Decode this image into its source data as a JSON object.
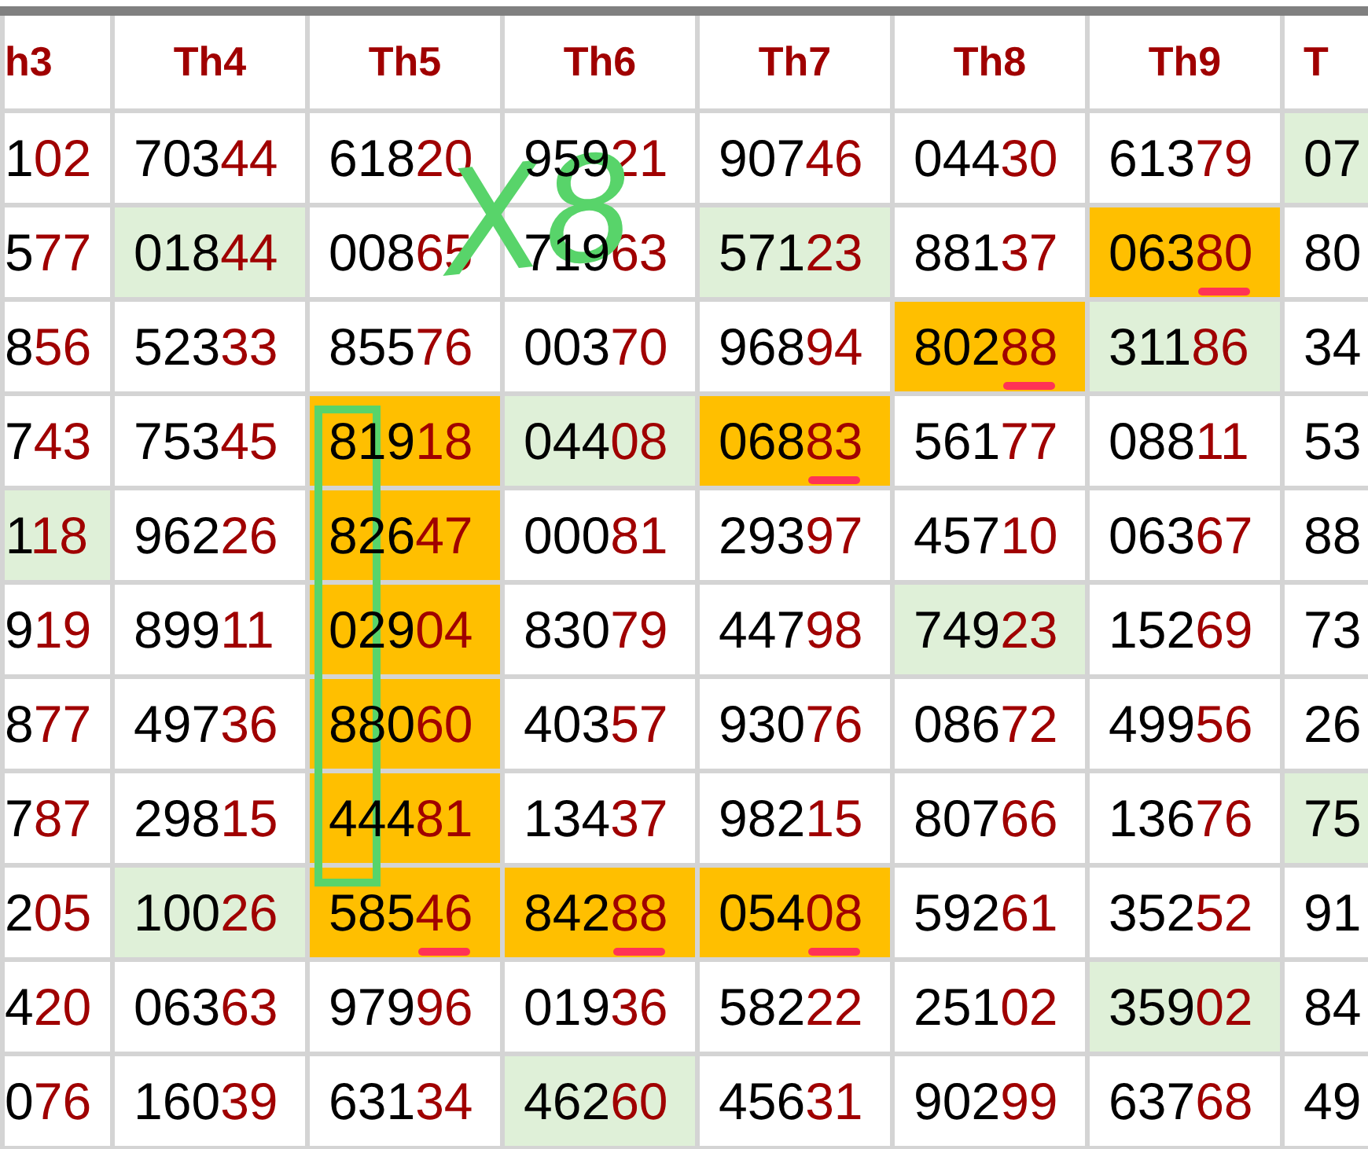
{
  "columns": [
    {
      "label": "h3"
    },
    {
      "label": "Th4"
    },
    {
      "label": "Th5"
    },
    {
      "label": "Th6"
    },
    {
      "label": "Th7"
    },
    {
      "label": "Th8"
    },
    {
      "label": "Th9"
    },
    {
      "label": "T"
    }
  ],
  "rows": [
    [
      {
        "head": "1",
        "tail": "02",
        "color": "#ffffff",
        "underlined": false
      },
      {
        "head": "703",
        "tail": "44",
        "color": "#ffffff",
        "underlined": false
      },
      {
        "head": "618",
        "tail": "20",
        "color": "#ffffff",
        "underlined": false
      },
      {
        "head": "959",
        "tail": "21",
        "color": "#ffffff",
        "underlined": false
      },
      {
        "head": "907",
        "tail": "46",
        "color": "#ffffff",
        "underlined": false
      },
      {
        "head": "044",
        "tail": "30",
        "color": "#ffffff",
        "underlined": false
      },
      {
        "head": "613",
        "tail": "79",
        "color": "#ffffff",
        "underlined": false
      },
      {
        "head": "07",
        "color": "#dff0d8"
      }
    ],
    [
      {
        "head": "5",
        "tail": "77",
        "color": "#ffffff",
        "underlined": false
      },
      {
        "head": "018",
        "tail": "44",
        "color": "#dff0d8",
        "underlined": false
      },
      {
        "head": "008",
        "tail": "65",
        "color": "#ffffff",
        "underlined": false
      },
      {
        "head": "719",
        "tail": "63",
        "color": "#ffffff",
        "underlined": false
      },
      {
        "head": "571",
        "tail": "23",
        "color": "#dff0d8",
        "underlined": false
      },
      {
        "head": "881",
        "tail": "37",
        "color": "#ffffff",
        "underlined": false
      },
      {
        "head": "063",
        "tail": "80",
        "color": "#ffbf00",
        "underlined": true
      },
      {
        "head": "80",
        "color": "#ffffff"
      }
    ],
    [
      {
        "head": "8",
        "tail": "56",
        "color": "#ffffff",
        "underlined": false
      },
      {
        "head": "523",
        "tail": "33",
        "color": "#ffffff",
        "underlined": false
      },
      {
        "head": "855",
        "tail": "76",
        "color": "#ffffff",
        "underlined": false
      },
      {
        "head": "003",
        "tail": "70",
        "color": "#ffffff",
        "underlined": false
      },
      {
        "head": "968",
        "tail": "94",
        "color": "#ffffff",
        "underlined": false
      },
      {
        "head": "802",
        "tail": "88",
        "color": "#ffbf00",
        "underlined": true
      },
      {
        "head": "311",
        "tail": "86",
        "color": "#dff0d8",
        "underlined": false
      },
      {
        "head": "34",
        "color": "#ffffff"
      }
    ],
    [
      {
        "head": "7",
        "tail": "43",
        "color": "#ffffff",
        "underlined": false
      },
      {
        "head": "753",
        "tail": "45",
        "color": "#ffffff",
        "underlined": false
      },
      {
        "head": "819",
        "tail": "18",
        "color": "#ffbf00",
        "underlined": false
      },
      {
        "head": "044",
        "tail": "08",
        "color": "#dff0d8",
        "underlined": false
      },
      {
        "head": "068",
        "tail": "83",
        "color": "#ffbf00",
        "underlined": true
      },
      {
        "head": "561",
        "tail": "77",
        "color": "#ffffff",
        "underlined": false
      },
      {
        "head": "088",
        "tail": "11",
        "color": "#ffffff",
        "underlined": false
      },
      {
        "head": "53",
        "color": "#ffffff"
      }
    ],
    [
      {
        "head": "1",
        "tail": "18",
        "color": "#dff0d8",
        "underlined": false
      },
      {
        "head": "962",
        "tail": "26",
        "color": "#ffffff",
        "underlined": false
      },
      {
        "head": "826",
        "tail": "47",
        "color": "#ffbf00",
        "underlined": false
      },
      {
        "head": "000",
        "tail": "81",
        "color": "#ffffff",
        "underlined": false
      },
      {
        "head": "293",
        "tail": "97",
        "color": "#ffffff",
        "underlined": false
      },
      {
        "head": "457",
        "tail": "10",
        "color": "#ffffff",
        "underlined": false
      },
      {
        "head": "063",
        "tail": "67",
        "color": "#ffffff",
        "underlined": false
      },
      {
        "head": "88",
        "color": "#ffffff"
      }
    ],
    [
      {
        "head": "9",
        "tail": "19",
        "color": "#ffffff",
        "underlined": false
      },
      {
        "head": "899",
        "tail": "11",
        "color": "#ffffff",
        "underlined": false
      },
      {
        "head": "029",
        "tail": "04",
        "color": "#ffbf00",
        "underlined": false
      },
      {
        "head": "830",
        "tail": "79",
        "color": "#ffffff",
        "underlined": false
      },
      {
        "head": "447",
        "tail": "98",
        "color": "#ffffff",
        "underlined": false
      },
      {
        "head": "749",
        "tail": "23",
        "color": "#dff0d8",
        "underlined": false
      },
      {
        "head": "152",
        "tail": "69",
        "color": "#ffffff",
        "underlined": false
      },
      {
        "head": "73",
        "color": "#ffffff"
      }
    ],
    [
      {
        "head": "8",
        "tail": "77",
        "color": "#ffffff",
        "underlined": false
      },
      {
        "head": "497",
        "tail": "36",
        "color": "#ffffff",
        "underlined": false
      },
      {
        "head": "880",
        "tail": "60",
        "color": "#ffbf00",
        "underlined": false
      },
      {
        "head": "403",
        "tail": "57",
        "color": "#ffffff",
        "underlined": false
      },
      {
        "head": "930",
        "tail": "76",
        "color": "#ffffff",
        "underlined": false
      },
      {
        "head": "086",
        "tail": "72",
        "color": "#ffffff",
        "underlined": false
      },
      {
        "head": "499",
        "tail": "56",
        "color": "#ffffff",
        "underlined": false
      },
      {
        "head": "26",
        "color": "#ffffff"
      }
    ],
    [
      {
        "head": "7",
        "tail": "87",
        "color": "#ffffff",
        "underlined": false
      },
      {
        "head": "298",
        "tail": "15",
        "color": "#ffffff",
        "underlined": false
      },
      {
        "head": "444",
        "tail": "81",
        "color": "#ffbf00",
        "underlined": false
      },
      {
        "head": "134",
        "tail": "37",
        "color": "#ffffff",
        "underlined": false
      },
      {
        "head": "982",
        "tail": "15",
        "color": "#ffffff",
        "underlined": false
      },
      {
        "head": "807",
        "tail": "66",
        "color": "#ffffff",
        "underlined": false
      },
      {
        "head": "136",
        "tail": "76",
        "color": "#ffffff",
        "underlined": false
      },
      {
        "head": "75",
        "color": "#dff0d8"
      }
    ],
    [
      {
        "head": "2",
        "tail": "05",
        "color": "#ffffff",
        "underlined": false
      },
      {
        "head": "100",
        "tail": "26",
        "color": "#dff0d8",
        "underlined": false
      },
      {
        "head": "585",
        "tail": "46",
        "color": "#ffbf00",
        "underlined": true
      },
      {
        "head": "842",
        "tail": "88",
        "color": "#ffbf00",
        "underlined": true
      },
      {
        "head": "054",
        "tail": "08",
        "color": "#ffbf00",
        "underlined": true
      },
      {
        "head": "592",
        "tail": "61",
        "color": "#ffffff",
        "underlined": false
      },
      {
        "head": "352",
        "tail": "52",
        "color": "#ffffff",
        "underlined": false
      },
      {
        "head": "91",
        "color": "#ffffff"
      }
    ],
    [
      {
        "head": "4",
        "tail": "20",
        "color": "#ffffff",
        "underlined": false
      },
      {
        "head": "063",
        "tail": "63",
        "color": "#ffffff",
        "underlined": false
      },
      {
        "head": "979",
        "tail": "96",
        "color": "#ffffff",
        "underlined": false
      },
      {
        "head": "019",
        "tail": "36",
        "color": "#ffffff",
        "underlined": false
      },
      {
        "head": "582",
        "tail": "22",
        "color": "#ffffff",
        "underlined": false
      },
      {
        "head": "251",
        "tail": "02",
        "color": "#ffffff",
        "underlined": false
      },
      {
        "head": "359",
        "tail": "02",
        "color": "#dff0d8",
        "underlined": false
      },
      {
        "head": "84",
        "color": "#ffffff"
      }
    ],
    [
      {
        "head": "0",
        "tail": "76",
        "color": "#ffffff",
        "underlined": false
      },
      {
        "head": "160",
        "tail": "39",
        "color": "#ffffff",
        "underlined": false
      },
      {
        "head": "631",
        "tail": "34",
        "color": "#ffffff",
        "underlined": false
      },
      {
        "head": "462",
        "tail": "60",
        "color": "#dff0d8",
        "underlined": false
      },
      {
        "head": "456",
        "tail": "31",
        "color": "#ffffff",
        "underlined": false
      },
      {
        "head": "902",
        "tail": "99",
        "color": "#ffffff",
        "underlined": false
      },
      {
        "head": "637",
        "tail": "68",
        "color": "#ffffff",
        "underlined": false
      },
      {
        "head": "49",
        "color": "#ffffff"
      }
    ]
  ],
  "handwritten_note": "X8"
}
